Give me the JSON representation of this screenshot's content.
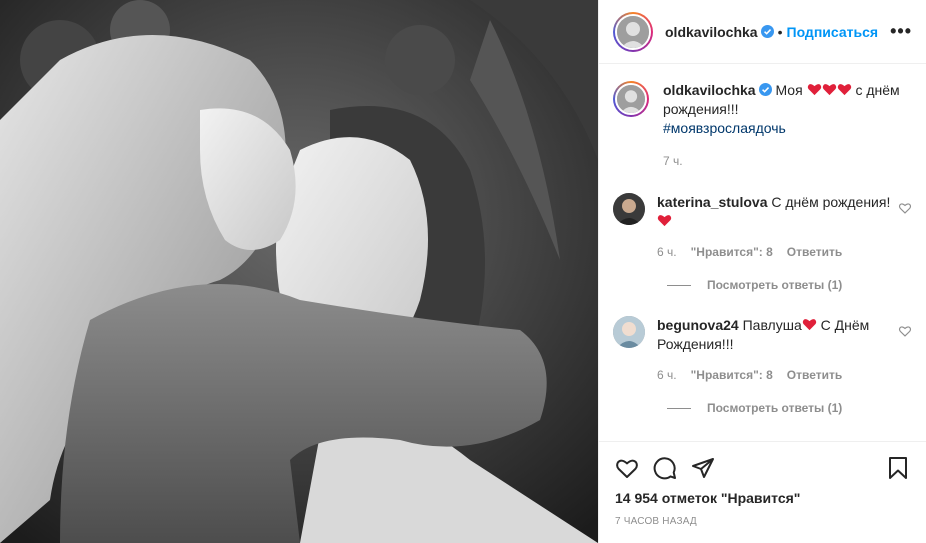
{
  "post": {
    "username": "oldkavilochka",
    "follow_label": "Подписаться",
    "more_label": "•••",
    "dot": "•"
  },
  "caption": {
    "username": "oldkavilochka",
    "text_prefix": "Моя",
    "text_suffix": "с днём рождения!!!",
    "hashtag": "#моявзрослаядочь",
    "time": "7 ч."
  },
  "comments": [
    {
      "username": "katerina_stulova",
      "text": "С днём рождения!",
      "time": "6 ч.",
      "likes": "\"Нравится\": 8",
      "reply": "Ответить",
      "view_replies": "Посмотреть ответы (1)"
    },
    {
      "username": "begunova24",
      "text_before": "Павлуша",
      "text_after": "С Днём Рождения!!!",
      "time": "6 ч.",
      "likes": "\"Нравится\": 8",
      "reply": "Ответить",
      "view_replies": "Посмотреть ответы (1)"
    }
  ],
  "footer": {
    "likes": "14 954 отметок \"Нравится\"",
    "time": "7 ЧАСОВ НАЗАД"
  },
  "icons": {
    "like": "heart-outline-icon",
    "comment": "comment-bubble-icon",
    "share": "paper-plane-icon",
    "save": "bookmark-icon",
    "verified": "verified-badge-icon",
    "colors": {
      "accent": "#0095f6",
      "heart": "#ed4956",
      "verified": "#3897f0"
    }
  }
}
